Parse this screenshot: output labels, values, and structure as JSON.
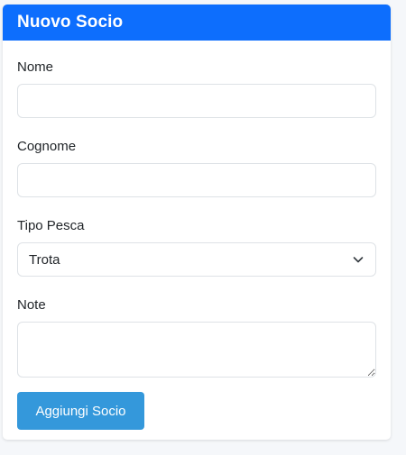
{
  "form": {
    "title": "Nuovo Socio",
    "fields": {
      "nome": {
        "label": "Nome",
        "value": "",
        "placeholder": ""
      },
      "cognome": {
        "label": "Cognome",
        "value": "",
        "placeholder": ""
      },
      "tipo_pesca": {
        "label": "Tipo Pesca",
        "selected": "Trota",
        "icon": "chevron-down-icon"
      },
      "note": {
        "label": "Note",
        "value": ""
      }
    },
    "submit_label": "Aggiungi Socio"
  },
  "colors": {
    "header": "#0d6efd",
    "button": "#3498db",
    "background": "#f5f7fa"
  }
}
